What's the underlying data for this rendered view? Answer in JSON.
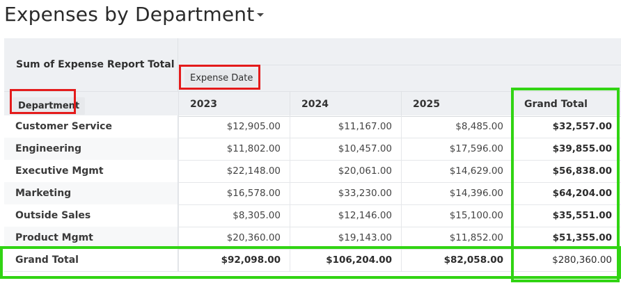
{
  "title": "Expenses by Department",
  "pivot": {
    "measure": "Sum of Expense Report Total",
    "column_field": "Expense Date",
    "row_field": "Department",
    "columns": [
      "2023",
      "2024",
      "2025",
      "Grand Total"
    ],
    "rows": [
      {
        "label": "Customer Service",
        "values": [
          "$12,905.00",
          "$11,167.00",
          "$8,485.00",
          "$32,557.00"
        ]
      },
      {
        "label": "Engineering",
        "values": [
          "$11,802.00",
          "$10,457.00",
          "$17,596.00",
          "$39,855.00"
        ]
      },
      {
        "label": "Executive Mgmt",
        "values": [
          "$22,148.00",
          "$20,061.00",
          "$14,629.00",
          "$56,838.00"
        ]
      },
      {
        "label": "Marketing",
        "values": [
          "$16,578.00",
          "$33,230.00",
          "$14,396.00",
          "$64,204.00"
        ]
      },
      {
        "label": "Outside Sales",
        "values": [
          "$8,305.00",
          "$12,146.00",
          "$15,100.00",
          "$35,551.00"
        ]
      },
      {
        "label": "Product Mgmt",
        "values": [
          "$20,360.00",
          "$19,143.00",
          "$11,852.00",
          "$51,355.00"
        ]
      }
    ],
    "grand_total": {
      "label": "Grand Total",
      "values": [
        "$92,098.00",
        "$106,204.00",
        "$82,058.00",
        "$280,360.00"
      ]
    }
  },
  "colors": {
    "highlight_red": "#e41b1b",
    "highlight_green": "#31d413",
    "header_bg": "#eef0f3"
  }
}
